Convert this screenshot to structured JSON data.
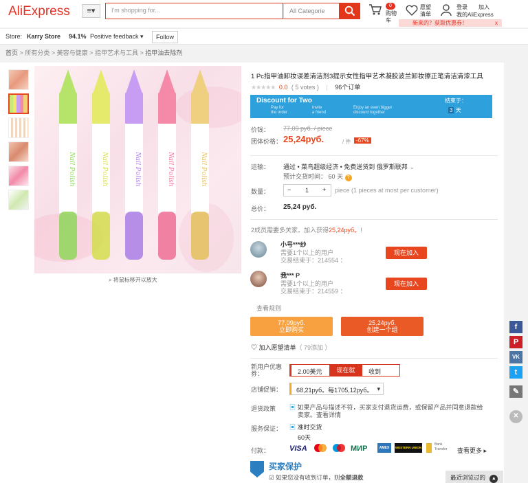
{
  "header": {
    "logo": "AliExpress",
    "menu_icon": "≡▾",
    "search_placeholder": "I'm shopping for...",
    "category": "All Categorie",
    "cart_count": "0",
    "cart_label_1": "购物",
    "cart_label_2": "车",
    "wishlist_label_1": "愿望",
    "wishlist_label_2": "清单",
    "signin": "登录",
    "join": "加入",
    "my_account": "我的AliExpress",
    "promo": "新来的？获取优惠券！",
    "promo_close": "x"
  },
  "store": {
    "label": "Store:",
    "name": "Karry Store",
    "feedback_pct": "94.1%",
    "feedback_text": "Positive feedback ▾",
    "follow": "Follow"
  },
  "breadcrumb": [
    "首页",
    "所有分类",
    "美容与健康",
    "指甲艺术与工具",
    "指甲油去除剂"
  ],
  "gallery": {
    "zoom_hint": "将鼠标移开以放大",
    "pen_text": "Nail Polish"
  },
  "product": {
    "title": "1 Pc指甲油卸妆误差清洁剂3提示女性指甲艺术凝胶波兰卸妆擦正笔清洁清漆工具",
    "rating": "0.0",
    "votes": "( 5 votes )",
    "orders": "96个订单",
    "discount_title": "Discount for Two",
    "discount_s1a": "Pay for",
    "discount_s1b": "the order",
    "discount_s2a": "Invite",
    "discount_s2b": "a friend",
    "discount_s3a": "Enjoy an even bigger",
    "discount_s3b": "discount together",
    "remaining_label": "结束于：",
    "remaining_days": "3",
    "remaining_unit": "天",
    "price_label": "价钱：",
    "price_old": "77,09 руб. / piece",
    "group_label": "团体价格：",
    "price_new": "25,24руб.",
    "per_piece": "/ 件",
    "discount_pct": "-67%",
    "shipping_label": "运输：",
    "shipping_text": "通过 • 菜鸟超级经济 • 免费送货到 俄罗斯联邦",
    "eta_text": "预计交货时间：",
    "eta_days": "60",
    "eta_unit": "天",
    "qty_label": "数量：",
    "qty_minus": "−",
    "qty_value": "1",
    "qty_plus": "+",
    "qty_note": "piece (1 pieces at most per customer)",
    "total_label": "总价：",
    "total": "25,24 руб.",
    "group_need_1": "2成员需要多关家。加入获得",
    "group_need_price": "25,24руб。",
    "group_need_2": "!",
    "group_members": [
      {
        "name": "小号***纱",
        "l1": "需要1个以上的用户",
        "l2": "交易结束于：",
        "time": "214554",
        "sep": "：",
        "btn": "现在加入"
      },
      {
        "name": "我*** P",
        "l1": "需要1个以上的用户",
        "l2": "交易结束于：",
        "time": "214559",
        "sep": "：",
        "btn": "现在加入"
      }
    ],
    "view_rules": "查看规则",
    "buy_alone_price": "77,09руб.",
    "buy_alone_label": "立即购买",
    "create_group_price": "25,24руб.",
    "create_group_label": "创建一个组",
    "wishlist_add": "加入愿望清单",
    "wishlist_count": "（ 79添加 ）",
    "newuser_label_1": "新用户优惠",
    "newuser_label_2": "券：",
    "coupon_amount": "2.00美元",
    "coupon_get": "现在就",
    "coupon_receive": "收到",
    "store_promo_label": "店铺促销：",
    "store_promo_text": "68,21руб。每1705,12руб。",
    "return_label": "退货政策",
    "return_text_1": "如果产品与描述不符，买家支付退货运费，或保留产品并同意退款给",
    "return_text_2": "卖家。查看详情",
    "guarantee_label": "服务保证：",
    "guarantee_text": "准时交货",
    "guarantee_days": "60天",
    "payment_label": "付款：",
    "payments": [
      "VISA",
      "MasterCard",
      "Maestro",
      "МИР",
      "AMEX",
      "WESTERN UNION",
      "Bank Transfer"
    ],
    "see_more": "查看更多 ▸",
    "buyer_protection": "买家保护",
    "buyer_protection_sub_1": "如果您没有收到订单，则",
    "buyer_protection_sub_2": "全额退款"
  },
  "social": [
    "f",
    "P",
    "VK",
    "t",
    "✎"
  ],
  "recently_viewed": "最近浏览过的"
}
